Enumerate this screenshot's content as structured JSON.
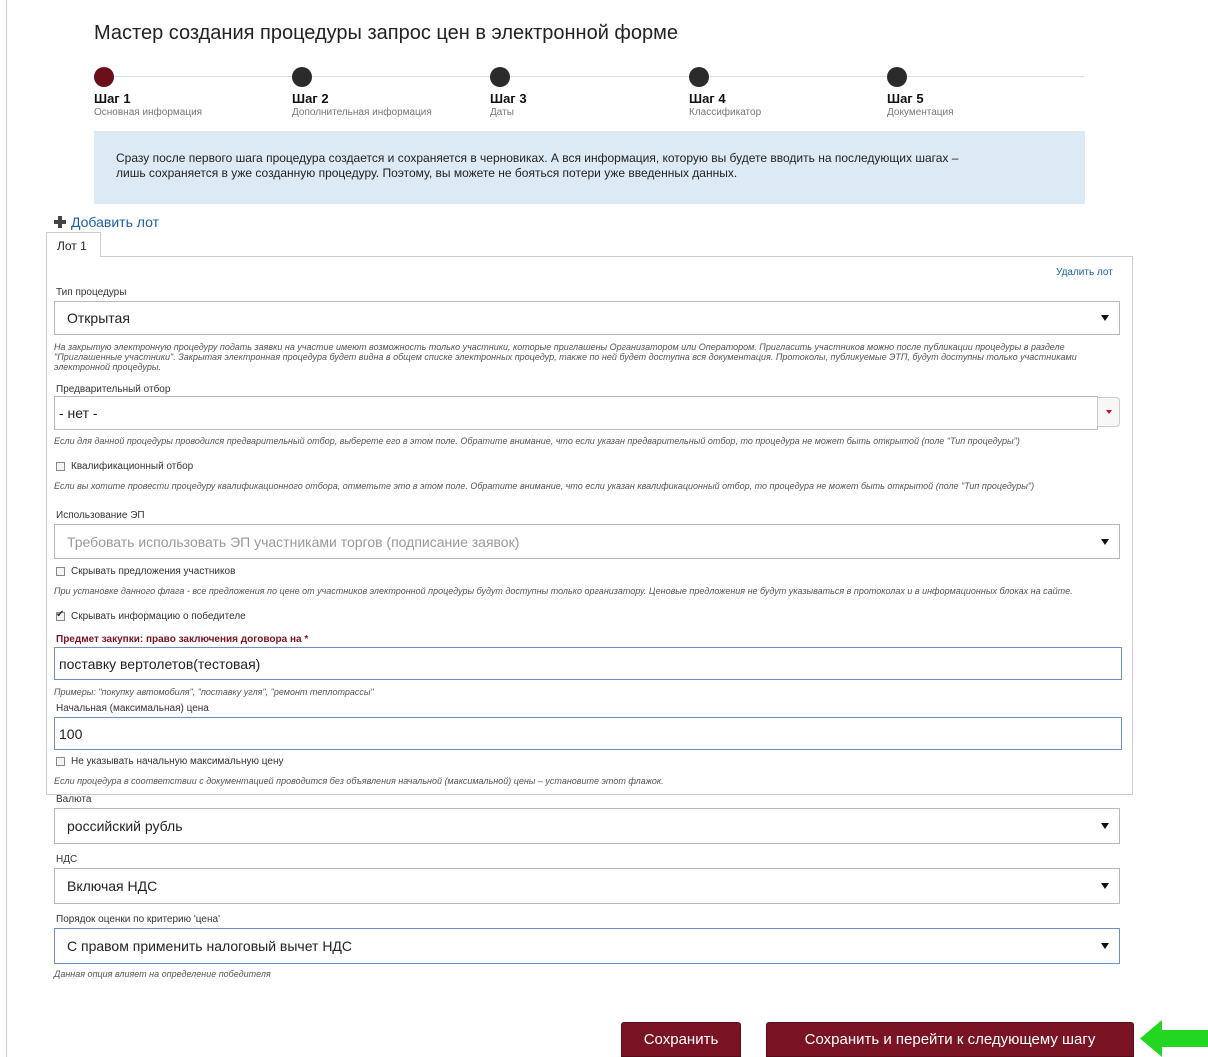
{
  "wizard": {
    "title": "Мастер создания процедуры запрос цен в электронной форме",
    "steps": [
      {
        "label": "Шаг 1",
        "sub": "Основная информация",
        "active": true
      },
      {
        "label": "Шаг 2",
        "sub": "Дополнительная информация",
        "active": false
      },
      {
        "label": "Шаг 3",
        "sub": "Даты",
        "active": false
      },
      {
        "label": "Шаг 4",
        "sub": "Классификатор",
        "active": false
      },
      {
        "label": "Шаг 5",
        "sub": "Документация",
        "active": false
      }
    ],
    "info_line1": "Сразу после первого шага процедура создается и сохраняется в черновиках. А вся информация, которую вы будете вводить на последующих шагах –",
    "info_line2": "лишь сохраняется в уже созданную процедуру. Поэтому, вы можете не бояться потери уже введенных данных."
  },
  "lots": {
    "add_label": "Добавить лот",
    "tab_label": "Лот 1",
    "delete_label": "Удалить лот"
  },
  "form": {
    "proc_type": {
      "label": "Тип процедуры",
      "value": "Открытая",
      "hint": "На закрытую электронную процедуру подать заявки на участие имеют возможность только участники, которые приглашены Организатором или Оператором. Пригласить участников можно после публикации процедуры в разделе \"Приглашенные участники\". Закрытая электронная процедура будет видна в общем списке электронных процедур, также по ней будет доступна вся документация. Протоколы, публикуемые ЭТП, будут доступны только участниками электронной процедуры."
    },
    "preselection": {
      "label": "Предварительный отбор",
      "value": "- нет -",
      "hint": "Если для данной процедуры проводился предварительный отбор, выберете его в этом поле. Обратите внимание, что если указан предварительный отбор, то процедура не может быть открытой (поле \"Тип процедуры\")"
    },
    "qualification": {
      "label": "Квалификационный отбор",
      "checked": false,
      "hint": "Если вы хотите провести процедуру квалификационного отбора, отметьте это в этом поле. Обратите внимание, что если указан квалификационный отбор, то процедура не может быть открытой (поле \"Тип процедуры\")"
    },
    "ep_usage": {
      "label": "Использование ЭП",
      "value": "Требовать использовать ЭП участниками торгов (подписание заявок)"
    },
    "hide_offers": {
      "label": "Скрывать предложения участников",
      "checked": false,
      "hint": "При установке данного флага - все предложения по цене от участников электронной процедуры будут доступны только организатору. Ценовые предложения не будут указываться в протоколах и в информационных блоках на сайте."
    },
    "hide_winner": {
      "label": "Скрывать информацию о победителе",
      "checked": true
    },
    "subject": {
      "label": "Предмет закупки: право заключения договора на *",
      "value": "поставку вертолетов(тестовая)",
      "hint": "Примеры: \"покупку автомобиля\", \"поставку угля\", \"ремонт теплотрассы\""
    },
    "start_price": {
      "label": "Начальная (максимальная) цена",
      "value": "100"
    },
    "no_start_price": {
      "label": "Не указывать начальную максимальную цену",
      "checked": false,
      "hint": "Если процедура в соответствии с документацией проводится без объявления начальной (максимальной) цены – установите этот флажок."
    },
    "currency": {
      "label": "Валюта",
      "value": "российский рубль"
    },
    "vat": {
      "label": "НДС",
      "value": "Включая НДС"
    },
    "price_criterion": {
      "label": "Порядок оценки по критерию 'цена'",
      "value": "С правом применить налоговый вычет НДС",
      "hint": "Данная опция влияет на определение победителя"
    }
  },
  "buttons": {
    "save": "Сохранить",
    "save_next": "Сохранить и перейти к следующему шагу"
  },
  "colors": {
    "accent": "#7a1323",
    "info_bg": "#dbeaf5",
    "link": "#1a5fa8",
    "annotation_arrow": "#22d622"
  }
}
